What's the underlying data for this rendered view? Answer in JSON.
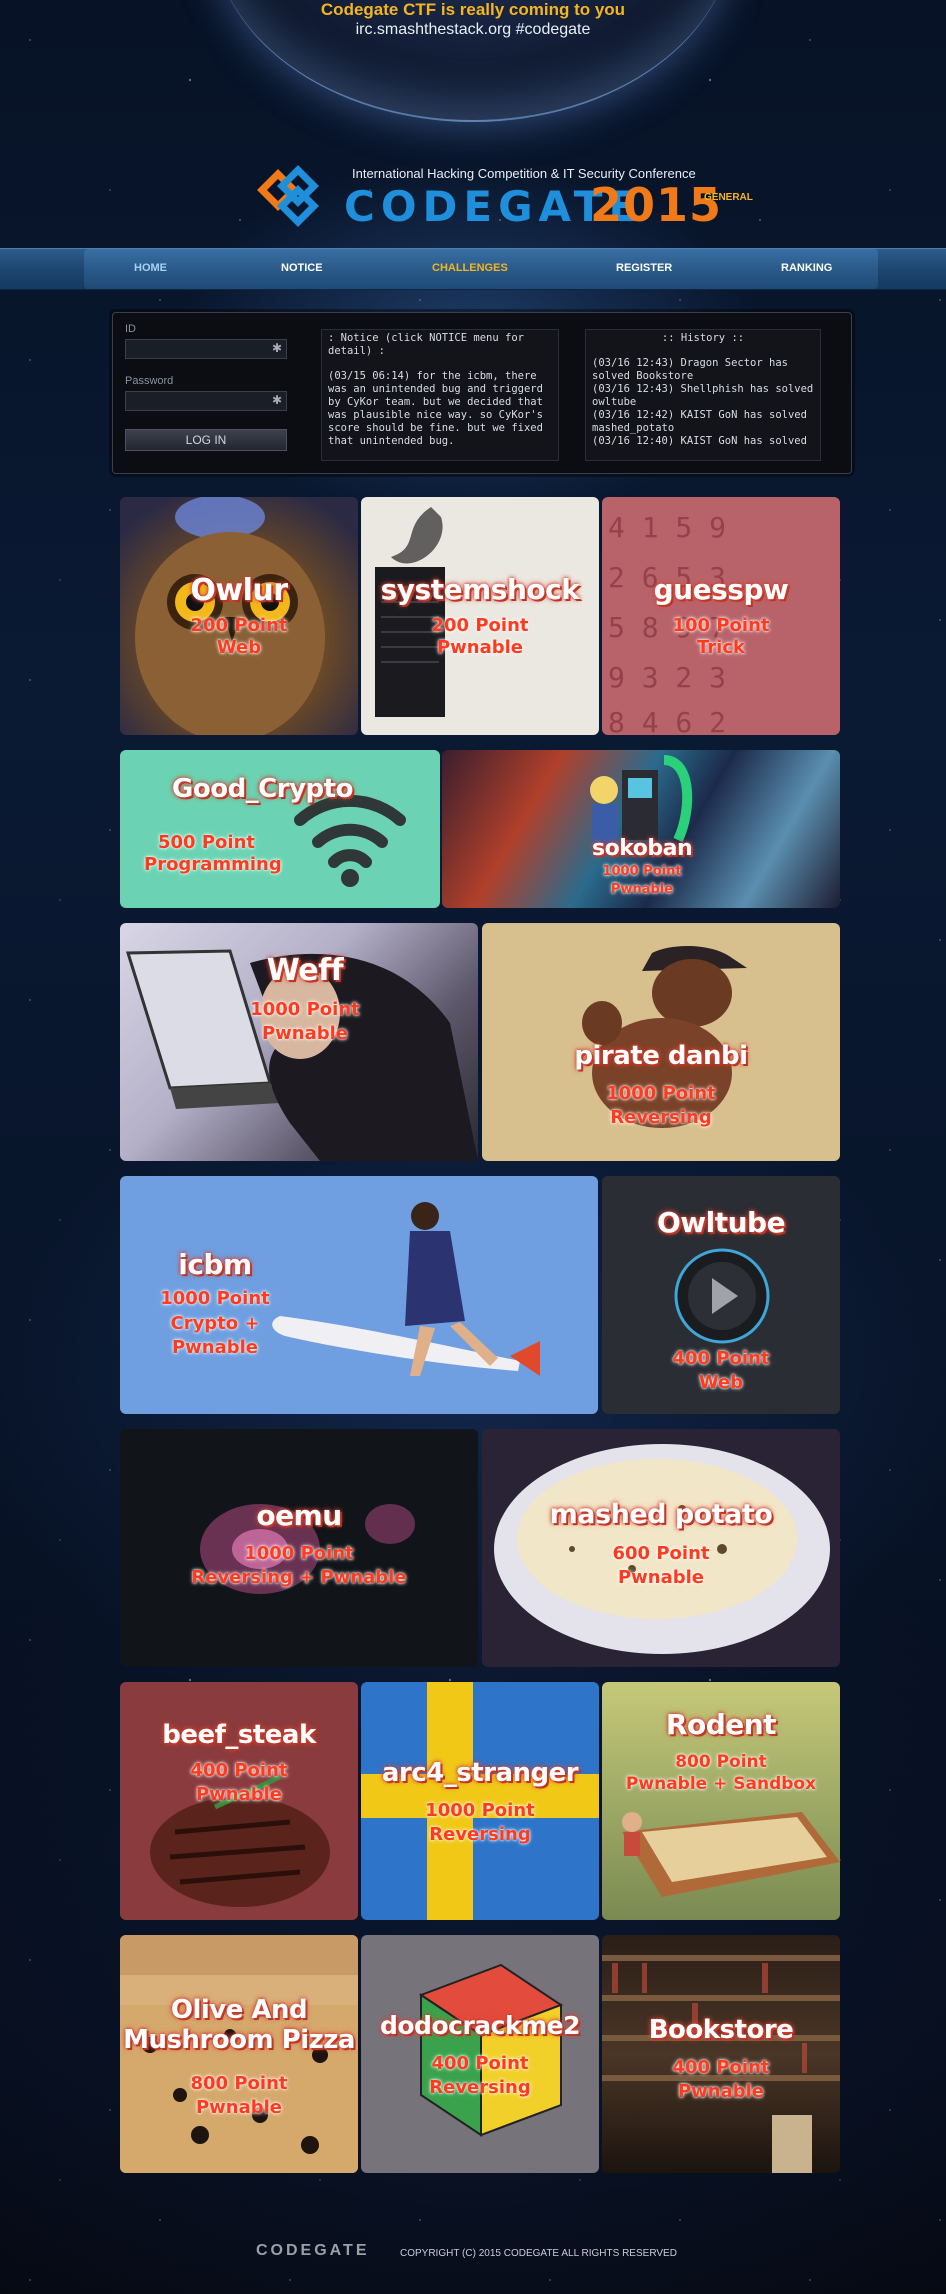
{
  "announcement": {
    "line1": "Codegate CTF is really coming to you",
    "line2": "irc.smashthestack.org #codegate"
  },
  "header": {
    "conference": "International Hacking Competition & IT Security Conference",
    "logo_text": "CODEGATE",
    "logo_year": "2015",
    "logo_edition": "GENERAL"
  },
  "nav": {
    "items": [
      {
        "label": "HOME"
      },
      {
        "label": "NOTICE"
      },
      {
        "label": "CHALLENGES"
      },
      {
        "label": "REGISTER"
      },
      {
        "label": "RANKING"
      }
    ]
  },
  "login": {
    "id_label": "ID",
    "password_label": "Password",
    "button": "LOG IN"
  },
  "notice": {
    "header": ": Notice (click NOTICE menu for detail) :",
    "body": "(03/15 06:14) for the icbm, there was an unintended bug and triggerd by CyKor team. but we decided that was plausible nice way. so CyKor's score should be fine. but we fixed that unintended bug."
  },
  "history": {
    "header": ":: History ::",
    "entries": [
      "(03/16 12:43) Dragon Sector has solved Bookstore",
      "(03/16 12:43) Shellphish has solved owltube",
      "(03/16 12:42) KAIST GoN has solved mashed_potato",
      "(03/16 12:40) KAIST GoN has solved"
    ]
  },
  "challenges": [
    {
      "title": "Owlur",
      "points": "200 Point",
      "category": "Web"
    },
    {
      "title": "systemshock",
      "points": "200 Point",
      "category": "Pwnable"
    },
    {
      "title": "guesspw",
      "points": "100 Point",
      "category": "Trick"
    },
    {
      "title": "Good_Crypto",
      "points": "500 Point",
      "category": "Programming"
    },
    {
      "title": "sokoban",
      "points": "1000 Point",
      "category": "Pwnable"
    },
    {
      "title": "Weff",
      "points": "1000 Point",
      "category": "Pwnable"
    },
    {
      "title": "pirate danbi",
      "points": "1000 Point",
      "category": "Reversing"
    },
    {
      "title": "icbm",
      "points": "1000 Point",
      "category": "Crypto + Pwnable"
    },
    {
      "title": "Owltube",
      "points": "400 Point",
      "category": "Web"
    },
    {
      "title": "oemu",
      "points": "1000 Point",
      "category": "Reversing + Pwnable"
    },
    {
      "title": "mashed potato",
      "points": "600 Point",
      "category": "Pwnable"
    },
    {
      "title": "beef_steak",
      "points": "400 Point",
      "category": "Pwnable"
    },
    {
      "title": "arc4_stranger",
      "points": "1000 Point",
      "category": "Reversing"
    },
    {
      "title": "Rodent",
      "points": "800 Point",
      "category": "Pwnable + Sandbox"
    },
    {
      "title": "Olive And Mushroom Pizza",
      "points": "800 Point",
      "category": "Pwnable"
    },
    {
      "title": "dodocrackme2",
      "points": "400 Point",
      "category": "Reversing"
    },
    {
      "title": "Bookstore",
      "points": "400 Point",
      "category": "Pwnable"
    }
  ],
  "footer": {
    "logo": "CODEGATE",
    "copyright": "COPYRIGHT (C) 2015 CODEGATE ALL RIGHTS RESERVED"
  }
}
